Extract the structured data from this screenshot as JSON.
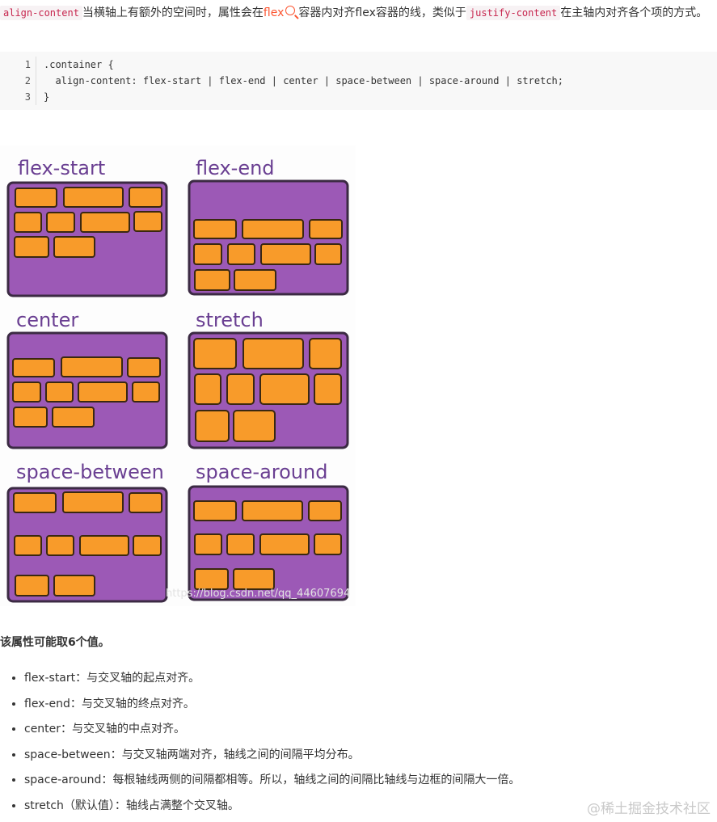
{
  "intro": {
    "code1": "align-content",
    "text1": "当横轴上有额外的空间时，属性会在",
    "link": "flex",
    "text2": "容器内对齐flex容器的线，类似于",
    "code2": "justify-content",
    "text3": "在主轴内对齐各个项的方式。"
  },
  "code_block": {
    "lines": [
      {
        "num": "1",
        "code": ".container {"
      },
      {
        "num": "2",
        "code": "  align-content: flex-start | flex-end | center | space-between | space-around | stretch;"
      },
      {
        "num": "3",
        "code": "}"
      }
    ]
  },
  "illustration": {
    "labels": [
      "flex-start",
      "flex-end",
      "center",
      "stretch",
      "space-between",
      "space-around"
    ],
    "watermark": "https://blog.csdn.net/qq_44607694",
    "panel_color": "#9c59b6",
    "brick_color": "#f89b2a",
    "label_color": "#6a3f92"
  },
  "subtitle": "该属性可能取6个值。",
  "values": [
    "flex-start：与交叉轴的起点对齐。",
    "flex-end：与交叉轴的终点对齐。",
    "center：与交叉轴的中点对齐。",
    "space-between：与交叉轴两端对齐，轴线之间的间隔平均分布。",
    "space-around：每根轴线两侧的间隔都相等。所以，轴线之间的间隔比轴线与边框的间隔大一倍。",
    "stretch（默认值）：轴线占满整个交叉轴。"
  ],
  "brand": "@稀土掘金技术社区"
}
